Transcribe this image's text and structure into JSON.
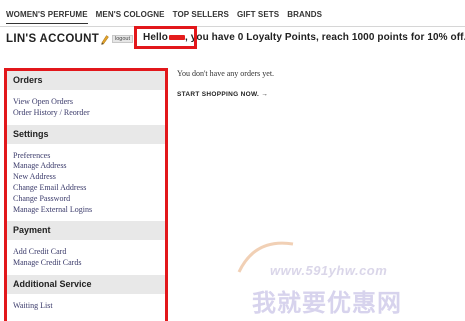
{
  "nav": {
    "items": [
      "WOMEN'S PERFUME",
      "MEN'S COLOGNE",
      "TOP SELLERS",
      "GIFT SETS",
      "BRANDS"
    ]
  },
  "header": {
    "account_title": "LIN'S ACCOUNT",
    "edit_icon": "pencil-icon",
    "logout_label": "logout",
    "greeting_hello": "Hello",
    "greeting_rest": ", you have 0 Loyalty Points, reach 1000 points for 10% off."
  },
  "sidebar": {
    "orders": {
      "title": "Orders",
      "links": [
        "View Open Orders",
        "Order History / Reorder"
      ]
    },
    "settings": {
      "title": "Settings",
      "links": [
        "Preferences",
        "Manage Address",
        "New Address",
        "Change Email Address",
        "Change Password",
        "Manage External Logins"
      ]
    },
    "payment": {
      "title": "Payment",
      "links": [
        "Add Credit Card",
        "Manage Credit Cards"
      ]
    },
    "additional": {
      "title": "Additional Service",
      "links": [
        "Waiting List"
      ]
    }
  },
  "main": {
    "empty_message": "You don't have any orders yet.",
    "shop_link": "START SHOPPING NOW. →"
  },
  "watermark": {
    "url": "www.591yhw.com",
    "text": "我就要优惠网"
  },
  "colors": {
    "highlight_red": "#e2171b",
    "section_header_bg": "#e8e8e8",
    "link_color": "#3a3a6a"
  }
}
